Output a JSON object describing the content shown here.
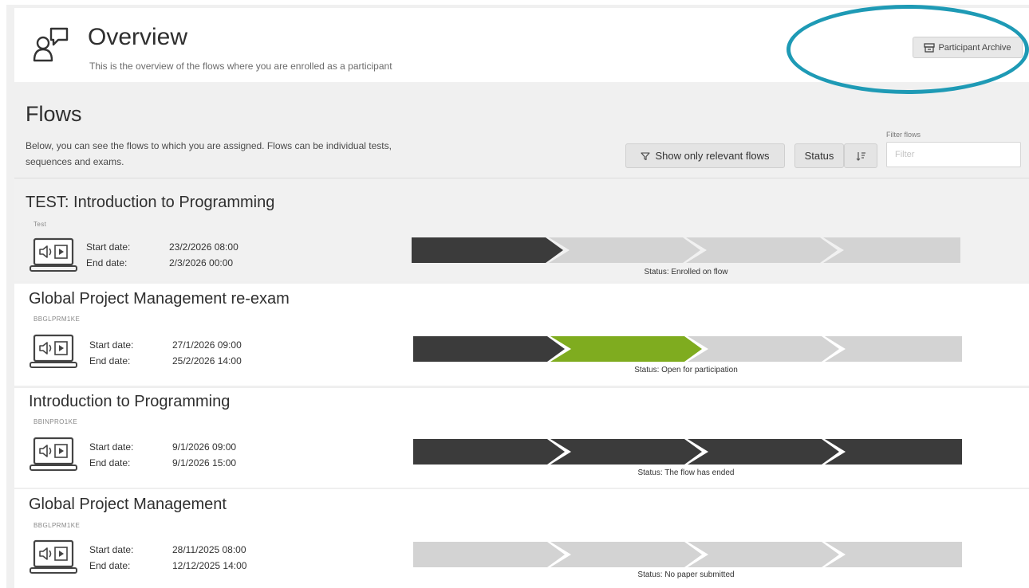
{
  "header": {
    "title": "Overview",
    "subtitle": "This is the overview of the flows where you are enrolled as a participant",
    "archive_button": "Participant Archive"
  },
  "flows_section": {
    "title": "Flows",
    "description": "Below, you can see the flows to which you are assigned. Flows can be individual tests, sequences and exams.",
    "relevant_button": "Show only relevant flows",
    "status_button": "Status",
    "filter_label": "Filter flows",
    "filter_placeholder": "Filter"
  },
  "labels": {
    "start": "Start date:",
    "end": "End date:"
  },
  "flows": [
    {
      "name": "TEST: Introduction to Programming",
      "code": "Test",
      "start": "23/2/2026 08:00",
      "end": "2/3/2026 00:00",
      "status": "Status: Enrolled on flow",
      "steps": [
        "dark",
        "light",
        "light",
        "light"
      ]
    },
    {
      "name": "Global Project Management re-exam",
      "code": "BBGLPRM1KE",
      "start": "27/1/2026 09:00",
      "end": "25/2/2026 14:00",
      "status": "Status: Open for participation",
      "steps": [
        "dark",
        "green",
        "light",
        "light"
      ]
    },
    {
      "name": "Introduction to Programming",
      "code": "BBINPRO1KE",
      "start": "9/1/2026 09:00",
      "end": "9/1/2026 15:00",
      "status": "Status: The flow has ended",
      "steps": [
        "dark",
        "dark",
        "dark",
        "dark"
      ]
    },
    {
      "name": "Global Project Management",
      "code": "BBGLPRM1KE",
      "start": "28/11/2025 08:00",
      "end": "12/12/2025 14:00",
      "status": "Status: No paper submitted",
      "steps": [
        "light",
        "light",
        "light",
        "light"
      ]
    }
  ],
  "colors": {
    "dark": "#3b3b3b",
    "light": "#d3d3d3",
    "green": "#7fac1f",
    "accent": "#1e9ab5"
  }
}
